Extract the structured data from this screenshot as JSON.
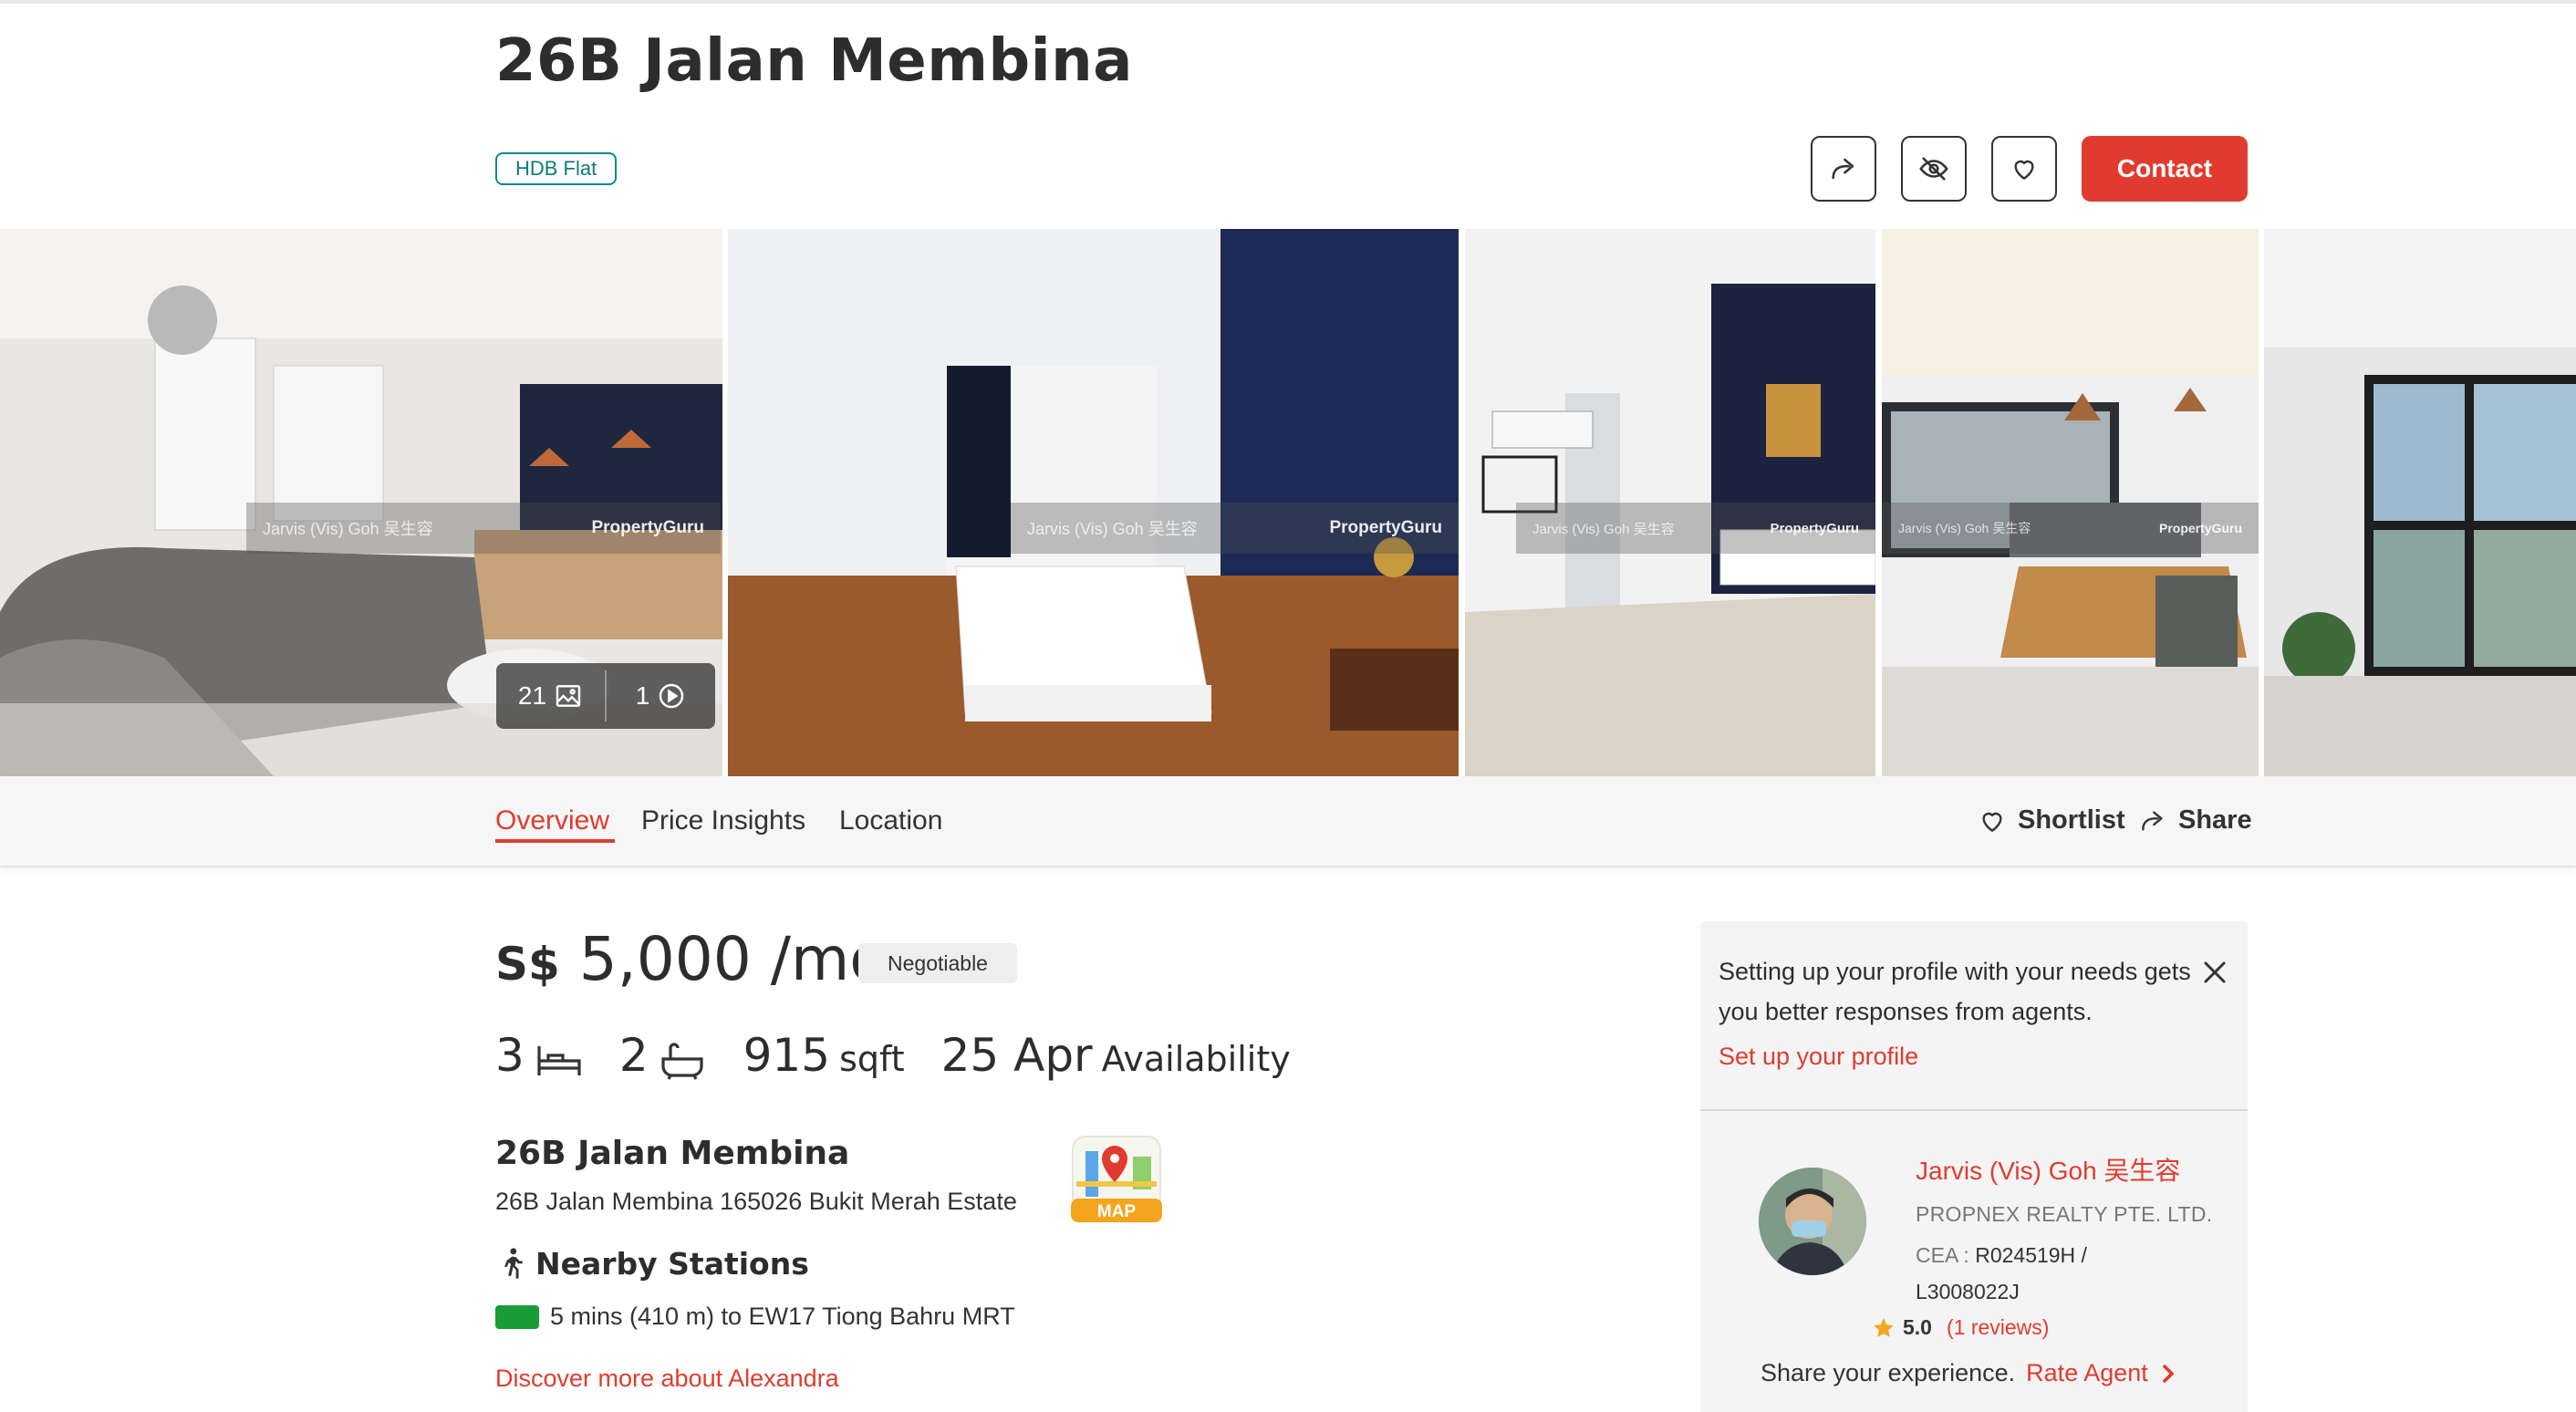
{
  "listing": {
    "title": "26B Jalan Membina",
    "property_type_tag": "HDB Flat",
    "contact_label": "Contact"
  },
  "gallery": {
    "photo_count": "21",
    "video_count": "1",
    "watermark_agent": "Jarvis (Vis) Goh 吴生容",
    "watermark_brand": "PropertyGuru"
  },
  "tabs": {
    "items": [
      "Overview",
      "Price Insights",
      "Location"
    ],
    "active": "Overview",
    "shortlist_label": "Shortlist",
    "share_label": "Share"
  },
  "price": {
    "currency": "S$",
    "amount": "5,000",
    "period": "/mo",
    "badge": "Negotiable"
  },
  "specs": {
    "bedrooms": "3",
    "bathrooms": "2",
    "size_value": "915",
    "size_unit": "sqft",
    "availability_date": "25 Apr",
    "availability_label": "Availability"
  },
  "address": {
    "title": "26B Jalan Membina",
    "full": "26B Jalan Membina 165026 Bukit Merah Estate",
    "map_label": "MAP"
  },
  "nearby": {
    "heading": "Nearby Stations",
    "stations": [
      "5 mins (410 m) to EW17 Tiong Bahru MRT"
    ],
    "line_color": "#1a9c38",
    "discover_link": "Discover more about Alexandra"
  },
  "profile_prompt": {
    "message": "Setting up your profile with your needs gets you better responses from agents.",
    "link": "Set up your profile"
  },
  "agent": {
    "name": "Jarvis (Vis) Goh 吴生容",
    "agency": "PROPNEX REALTY PTE. LTD.",
    "cea_label": "CEA :",
    "cea_number": "R024519H /",
    "cea_number_2": "L3008022J",
    "rating": "5.0",
    "reviews": "(1 reviews)",
    "share_prompt": "Share your experience.",
    "rate_link": "Rate Agent"
  },
  "colors": {
    "accent": "#e13b2f",
    "tag_teal": "#0d8a8a",
    "mrt_green": "#1a9c38",
    "star": "#f5a623"
  }
}
